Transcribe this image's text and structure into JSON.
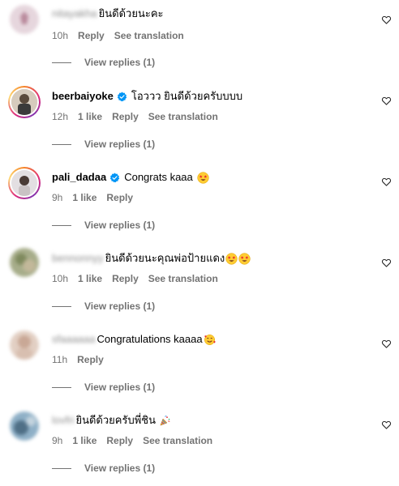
{
  "comments": [
    {
      "username": "nitayakha",
      "blurred": true,
      "verified": false,
      "text": "ยินดีด้วยนะคะ",
      "time": "10h",
      "likes": "",
      "reply": "Reply",
      "translate": "See translation",
      "view_replies": "View replies (1)",
      "avatar_color": "#d9b8c4"
    },
    {
      "username": "beerbaiyoke",
      "blurred": false,
      "verified": true,
      "text": "โอววว ยินดีด้วยครับบบบ",
      "time": "12h",
      "likes": "1 like",
      "reply": "Reply",
      "translate": "See translation",
      "view_replies": "View replies (1)",
      "avatar_color": "#b9a58c"
    },
    {
      "username": "pali_dadaa",
      "blurred": false,
      "verified": true,
      "text": "Congrats kaaa",
      "time": "9h",
      "likes": "1 like",
      "reply": "Reply",
      "translate": "",
      "view_replies": "View replies (1)",
      "avatar_color": "#c7c2c8"
    },
    {
      "username": "bennonnyy",
      "blurred": true,
      "verified": false,
      "text": "ยินดีด้วยนะคุณพ่อป้ายแดง",
      "time": "10h",
      "likes": "1 like",
      "reply": "Reply",
      "translate": "See translation",
      "view_replies": "View replies (1)",
      "avatar_color": "#9aa67d"
    },
    {
      "username": "sfaaaaaa",
      "blurred": true,
      "verified": false,
      "text": "Congratulations kaaaa",
      "time": "11h",
      "likes": "",
      "reply": "Reply",
      "translate": "",
      "view_replies": "View replies (1)",
      "avatar_color": "#d2b6a4"
    },
    {
      "username": "lovfri",
      "blurred": true,
      "verified": false,
      "text": "ยินดีด้วยครับพี่ชิน",
      "time": "9h",
      "likes": "1 like",
      "reply": "Reply",
      "translate": "See translation",
      "view_replies": "View replies (1)",
      "avatar_color": "#6f8fa8"
    }
  ],
  "icons": {
    "heart": "heart-outline-icon",
    "verified": "verified-badge-icon"
  },
  "colors": {
    "verified_blue": "#0095f6",
    "meta_gray": "#737373"
  }
}
